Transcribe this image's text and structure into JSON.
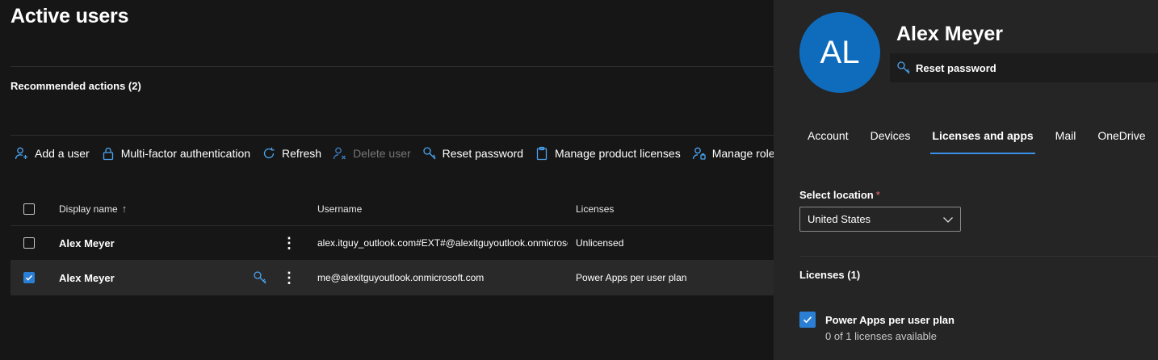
{
  "page": {
    "title": "Active users"
  },
  "recommended": {
    "title": "Recommended actions (2)"
  },
  "toolbar": {
    "add_user": "Add a user",
    "mfa": "Multi-factor authentication",
    "refresh": "Refresh",
    "delete_user": "Delete user",
    "reset_password": "Reset password",
    "manage_licenses": "Manage product licenses",
    "manage_roles": "Manage roles"
  },
  "grid": {
    "headers": {
      "display_name": "Display name",
      "sort_arrow": "↑",
      "username": "Username",
      "licenses": "Licenses"
    },
    "rows": [
      {
        "name": "Alex Meyer",
        "username": "alex.itguy_outlook.com#EXT#@alexitguyoutlook.onmicrosoft.com",
        "licenses": "Unlicensed",
        "selected": false
      },
      {
        "name": "Alex Meyer",
        "username": "me@alexitguyoutlook.onmicrosoft.com",
        "licenses": "Power Apps per user plan",
        "selected": true
      }
    ],
    "kebab": "⋮"
  },
  "panel": {
    "initials": "AL",
    "name": "Alex Meyer",
    "reset_password": "Reset password",
    "tabs": [
      "Account",
      "Devices",
      "Licenses and apps",
      "Mail",
      "OneDrive"
    ],
    "active_tab": "Licenses and apps",
    "location_label": "Select location",
    "required_mark": "*",
    "location_value": "United States",
    "licenses_title": "Licenses (1)",
    "license_name": "Power Apps per user plan",
    "license_availability": "0 of 1 licenses available"
  },
  "colors": {
    "accent": "#2a7fd4",
    "avatar": "#0f6cbd",
    "background": "#161616",
    "panel": "#252525"
  },
  "icons": [
    "add-user-icon",
    "lock-icon",
    "refresh-icon",
    "delete-user-icon",
    "key-icon",
    "clipboard-icon",
    "manage-roles-icon",
    "chevron-down-icon",
    "checkmark-icon",
    "more-options-icon"
  ]
}
